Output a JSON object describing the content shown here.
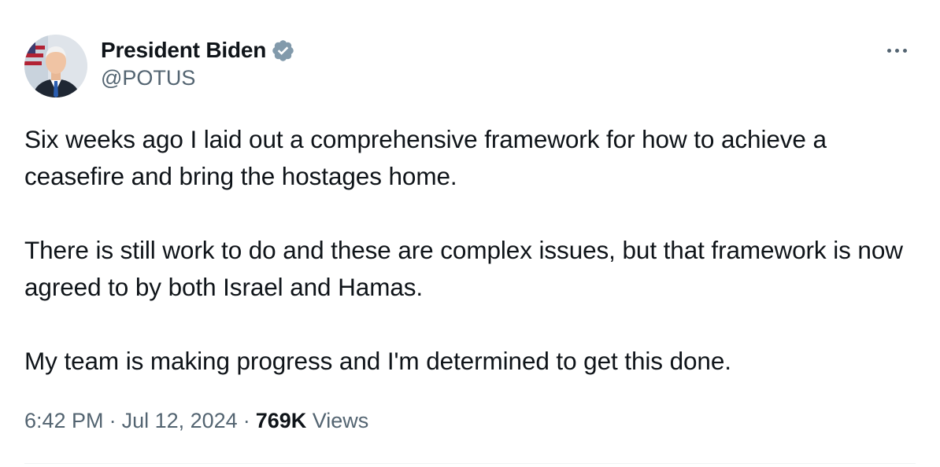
{
  "author": {
    "display_name": "President Biden",
    "handle": "@POTUS",
    "verified_badge_icon": "verified-badge-icon",
    "badge_color": "#829aab"
  },
  "tweet": {
    "paragraphs": [
      "Six weeks ago I laid out a comprehensive framework for how to achieve a ceasefire and bring the hostages home.",
      "There is still work to do and these are complex issues, but that framework is now agreed to by both Israel and Hamas.",
      "My team is making progress and I'm determined to get this done."
    ],
    "time": "6:42 PM",
    "date": "Jul 12, 2024",
    "separator": "·",
    "views_count": "769K",
    "views_label": "Views"
  },
  "more_icon": "more-options-icon",
  "colors": {
    "text": "#0f1419",
    "secondary": "#536471",
    "divider": "#eff3f4"
  }
}
